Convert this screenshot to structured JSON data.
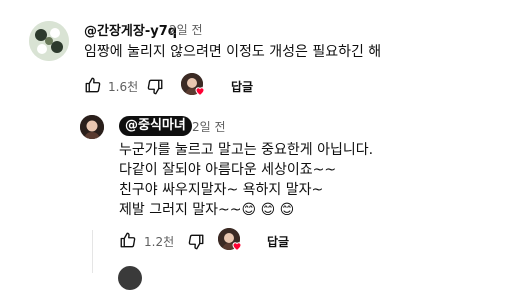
{
  "comment": {
    "handle": "@간장게장-y7q",
    "time": "2일 전",
    "text": "임짱에 눌리지 않으려면 이정도 개성은 필요하긴 해",
    "likes": "1.6천",
    "reply_label": "답글"
  },
  "reply": {
    "handle": "@중식마녀",
    "time": "2일 전",
    "lines": [
      "누군가를 눌르고 말고는 중요한게 아닙니다.",
      "다같이 잘되야 아름다운 세상이죠~~",
      "친구야 싸우지말자~ 욕하지 말자~",
      "제발 그러지 말자~~😊 😊 😊"
    ],
    "likes": "1.2천",
    "reply_label": "답글"
  },
  "colors": {
    "heart": "#ff0033",
    "secondary_text": "#606060"
  }
}
